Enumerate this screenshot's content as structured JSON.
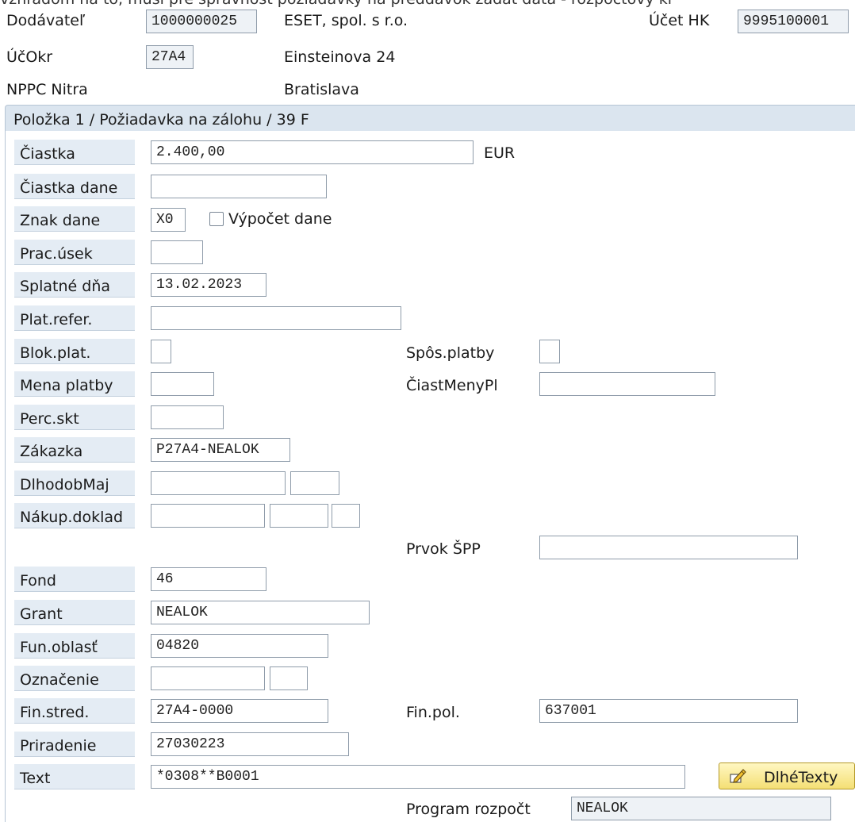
{
  "top_cut_text": "vzhľadom na to, musí pre správnosť požiadavky na preddavok zadať dáta - rozpočtový kľ",
  "header": {
    "vendor_label": "Dodávateľ",
    "vendor_value": "1000000025",
    "vendor_name": "ESET, spol. s r.o.",
    "gl_account_label": "Účet HK",
    "gl_account_value": "9995100001",
    "cocode_label": "ÚčOkr",
    "cocode_value": "27A4",
    "street": "Einsteinova 24",
    "org_name": "NPPC Nitra",
    "city": "Bratislava"
  },
  "panel": {
    "title": "Položka 1 / Požiadavka na zálohu / 39 F"
  },
  "fields": {
    "amount": {
      "label": "Čiastka",
      "value": "2.400,00",
      "currency": "EUR"
    },
    "tax_amount": {
      "label": "Čiastka dane",
      "value": ""
    },
    "tax_code": {
      "label": "Znak dane",
      "value": "X0",
      "calc_label": "Výpočet dane"
    },
    "business_area": {
      "label": "Prac.úsek",
      "value": ""
    },
    "due_on": {
      "label": "Splatné dňa",
      "value": "13.02.2023"
    },
    "payment_ref": {
      "label": "Plat.refer.",
      "value": ""
    },
    "payment_block": {
      "label": "Blok.plat.",
      "value": ""
    },
    "payment_method": {
      "label": "Spôs.platby",
      "value": ""
    },
    "payment_currency": {
      "label": "Mena platby",
      "value": ""
    },
    "pay_currency_amount": {
      "label": "ČiastMenyPl",
      "value": ""
    },
    "discount_percent": {
      "label": "Perc.skt",
      "value": ""
    },
    "order": {
      "label": "Zákazka",
      "value": "P27A4-NEALOK"
    },
    "asset": {
      "label": "DlhodobMaj",
      "value": "",
      "value2": ""
    },
    "purchasing_doc": {
      "label": "Nákup.doklad",
      "value": "",
      "value2": "",
      "value3": ""
    },
    "wbs_element": {
      "label": "Prvok ŠPP",
      "value": ""
    },
    "fund": {
      "label": "Fond",
      "value": "46"
    },
    "grant": {
      "label": "Grant",
      "value": "NEALOK"
    },
    "functional_area": {
      "label": "Fun.oblasť",
      "value": "04820"
    },
    "earmarked": {
      "label": "Označenie",
      "value": "",
      "value2": ""
    },
    "funds_center": {
      "label": "Fin.stred.",
      "value": "27A4-0000"
    },
    "commitment_item": {
      "label": "Fin.pol.",
      "value": "637001"
    },
    "assignment": {
      "label": "Priradenie",
      "value": "27030223"
    },
    "text": {
      "label": "Text",
      "value": "*0308**B0001"
    },
    "budget_program": {
      "label": "Program rozpočt",
      "value": "NEALOK"
    }
  },
  "buttons": {
    "long_texts": "DlhéTexty"
  },
  "icons": {
    "long_texts_icon": "pencil-note-icon"
  }
}
